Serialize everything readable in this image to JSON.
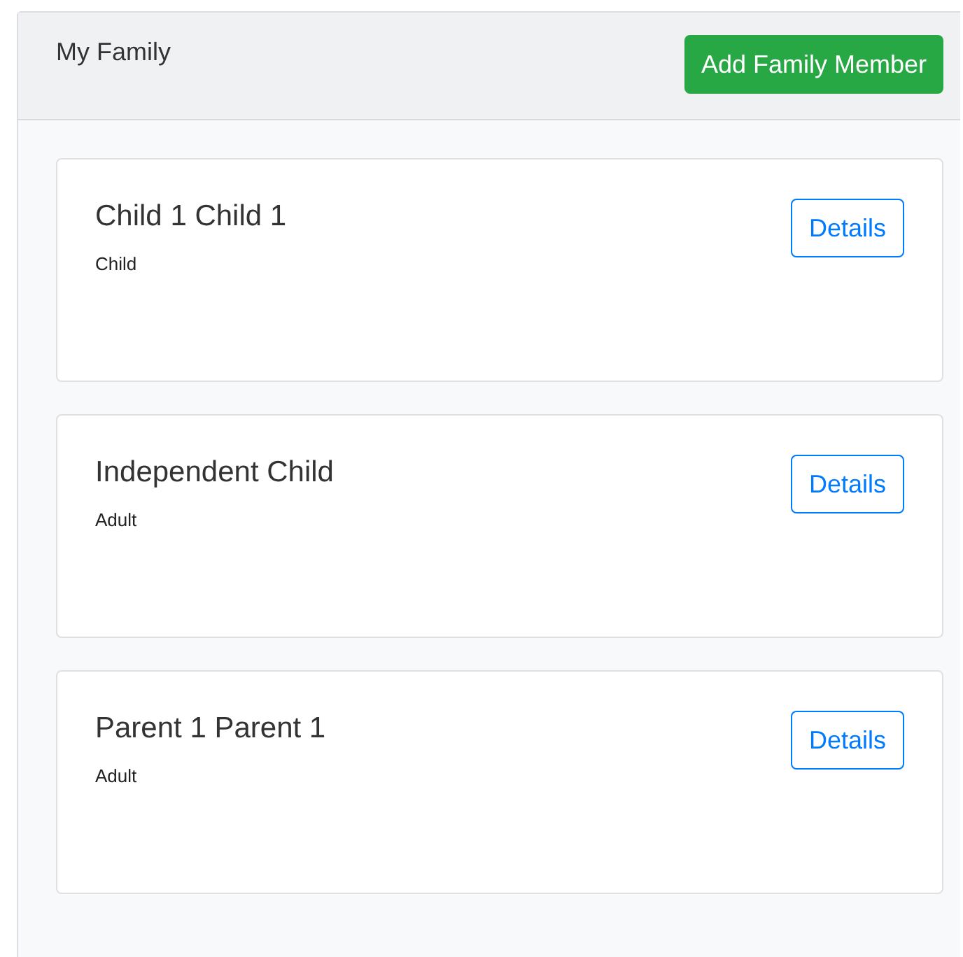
{
  "header": {
    "title": "My Family",
    "action": "Add Family Member"
  },
  "members": [
    {
      "name": "Child 1 Child 1",
      "role": "Child",
      "button": "Details"
    },
    {
      "name": "Independent Child",
      "role": "Adult",
      "button": "Details"
    },
    {
      "name": "Parent 1 Parent 1",
      "role": "Adult",
      "button": "Details"
    }
  ]
}
